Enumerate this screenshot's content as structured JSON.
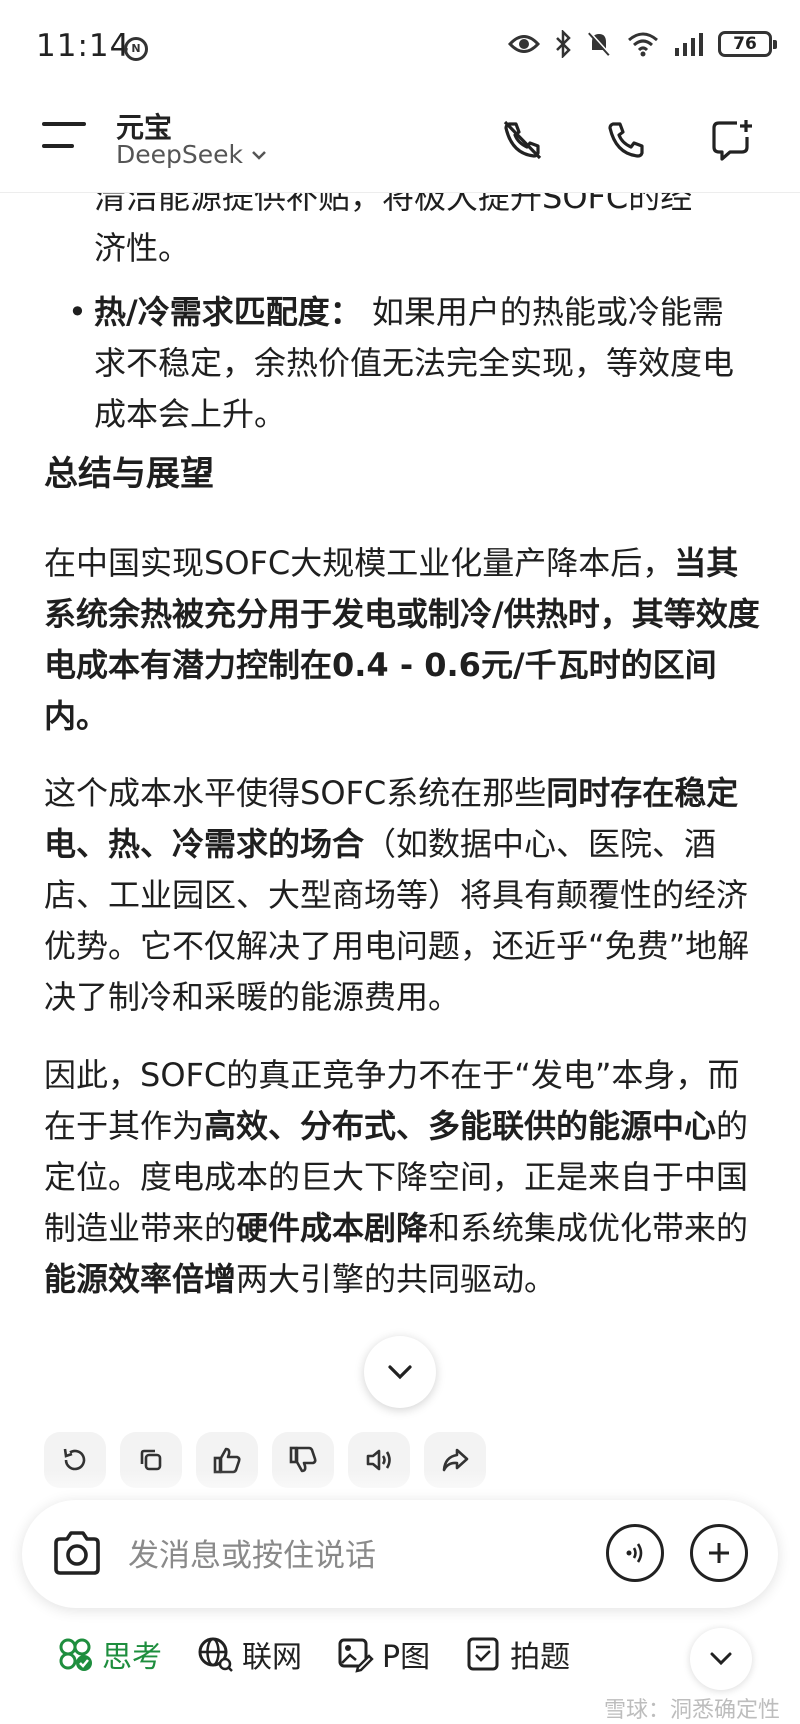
{
  "status": {
    "time": "11:14",
    "notif_badge": "N",
    "battery": "76"
  },
  "header": {
    "title": "元宝",
    "model": "DeepSeek"
  },
  "content": {
    "partial_top": "清洁能源提供补贴，将极大提升SOFC的经",
    "partial_top_cont": "济性。",
    "bullet": {
      "bold": "热/冷需求匹配度",
      "colon": "：",
      "text": " 如果用户的热能或冷能需求不稳定，余热价值无法完全实现，等效度电成本会上升。"
    },
    "heading": "总结与展望",
    "p1": {
      "normal": "在中国实现SOFC大规模工业化量产降本后，",
      "bold": "当其系统余热被充分用于发电或制冷/供热时，其等效度电成本有潜力控制在0.4 - 0.6元/千瓦时的区间内。"
    },
    "p2": {
      "n1": "这个成本水平使得SOFC系统在那些",
      "b1": "同时存在稳定电、热、冷需求的场合",
      "n2": "（如数据中心、医院、酒店、工业园区、大型商场等）将具有颠覆性的经济优势。它不仅解决了用电问题，还近乎“免费”地解决了制冷和采暖的能源费用。"
    },
    "p3": {
      "n1": "因此，SOFC的真正竞争力不在于“发电”本身，而在于其作为",
      "b1": "高效、分布式、多能联供的能源中心",
      "n2": "的定位。度电成本的巨大下降空间，正是来自于中国制造业带来的",
      "b2": "硬件成本剧降",
      "n3": "和系统集成优化带来的",
      "b3": "能源效率倍增",
      "n4": "两大引擎的共同驱动。"
    }
  },
  "actions": [
    "refresh-icon",
    "copy-icon",
    "thumbs-up-icon",
    "thumbs-down-icon",
    "speaker-icon",
    "share-icon"
  ],
  "input": {
    "placeholder": "发消息或按住说话"
  },
  "tools": [
    {
      "label": "思考",
      "icon": "deep-think-icon",
      "active": true
    },
    {
      "label": "联网",
      "icon": "globe-icon",
      "active": false
    },
    {
      "label": "P图",
      "icon": "image-edit-icon",
      "active": false
    },
    {
      "label": "拍题",
      "icon": "question-scan-icon",
      "active": false
    }
  ],
  "watermark": "雪球：洞悉确定性",
  "colors": {
    "active_green": "#1e8e3e",
    "text": "#1f1f1f",
    "placeholder": "#8a8a8a"
  }
}
